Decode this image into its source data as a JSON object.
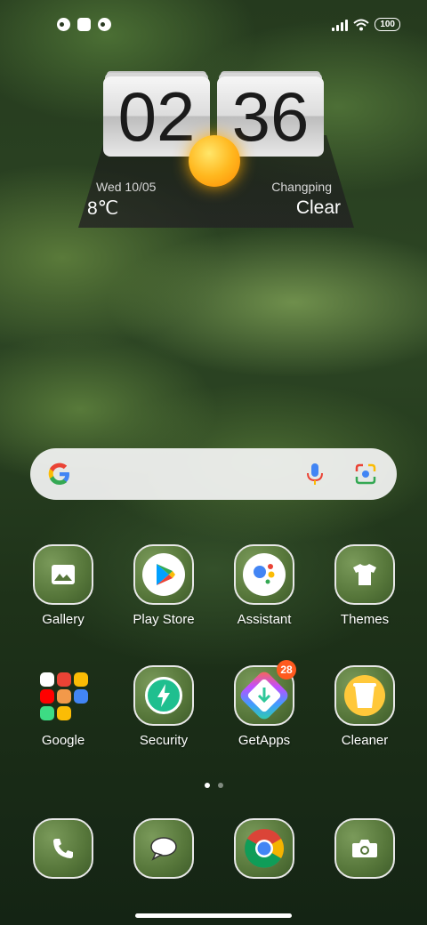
{
  "status": {
    "battery": "100"
  },
  "clock_widget": {
    "hour": "02",
    "minute": "36",
    "date": "Wed  10/05",
    "city": "Changping",
    "temperature": "8℃",
    "condition": "Clear"
  },
  "search": {
    "icons": [
      "google-logo-icon",
      "microphone-icon",
      "google-lens-icon"
    ]
  },
  "apps_row1": [
    {
      "label": "Gallery",
      "icon": "image-icon"
    },
    {
      "label": "Play Store",
      "icon": "play-store-icon"
    },
    {
      "label": "Assistant",
      "icon": "assistant-icon"
    },
    {
      "label": "Themes",
      "icon": "tshirt-icon"
    }
  ],
  "apps_row2": [
    {
      "label": "Google",
      "icon": "folder-icon"
    },
    {
      "label": "Security",
      "icon": "shield-bolt-icon"
    },
    {
      "label": "GetApps",
      "icon": "download-icon",
      "badge": "28"
    },
    {
      "label": "Cleaner",
      "icon": "cup-icon"
    }
  ],
  "dock": [
    {
      "icon": "phone-icon"
    },
    {
      "icon": "message-icon"
    },
    {
      "icon": "chrome-icon"
    },
    {
      "icon": "camera-icon"
    }
  ],
  "colors": {
    "badge": "#ff5a1f",
    "accent_sun": "#ffb81f"
  }
}
